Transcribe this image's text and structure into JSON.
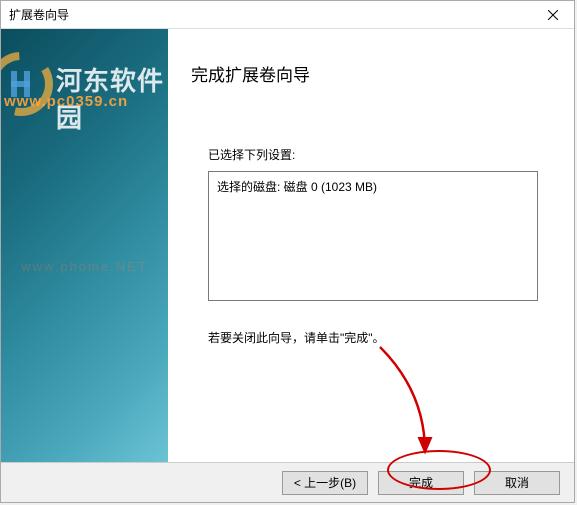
{
  "titlebar": {
    "title": "扩展卷向导"
  },
  "watermark": {
    "text1": "河东软件园",
    "text2": "www.pc0359.cn",
    "center": "www.phome.NET"
  },
  "content": {
    "heading": "完成扩展卷向导",
    "subheading": "已选择下列设置:",
    "settings_line": "选择的磁盘: 磁盘 0 (1023 MB)",
    "hint": "若要关闭此向导，请单击\"完成\"。"
  },
  "footer": {
    "back": "< 上一步(B)",
    "finish": "完成",
    "cancel": "取消"
  }
}
